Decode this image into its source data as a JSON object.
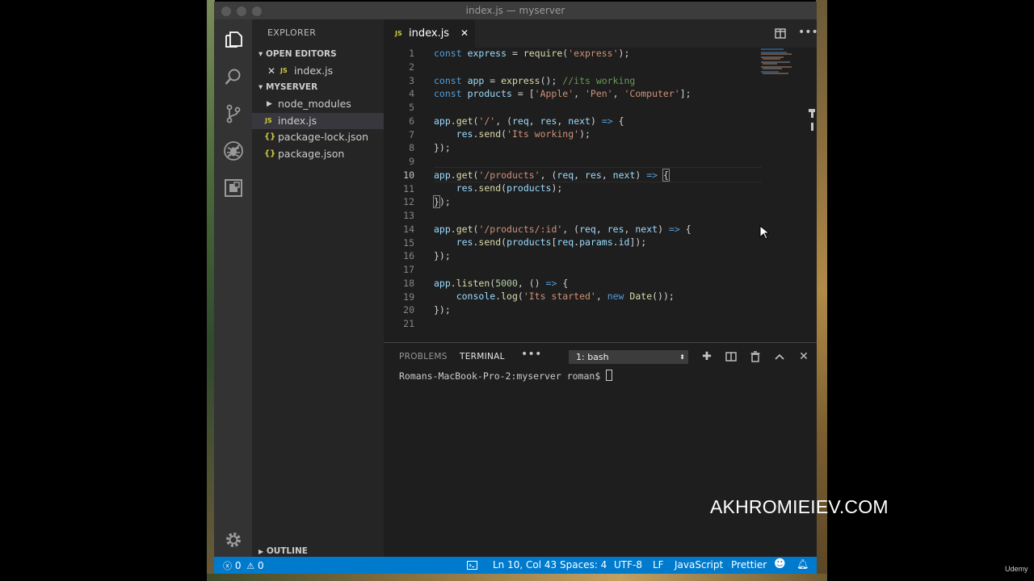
{
  "window": {
    "title": "index.js — myserver"
  },
  "sidebar": {
    "header": "EXPLORER",
    "open_editors_label": "OPEN EDITORS",
    "open_editors": [
      {
        "badge": "JS",
        "name": "index.js"
      }
    ],
    "project_label": "MYSERVER",
    "files": [
      {
        "type": "folder",
        "name": "node_modules"
      },
      {
        "type": "js",
        "badge": "JS",
        "name": "index.js"
      },
      {
        "type": "json",
        "badge": "{}",
        "name": "package-lock.json"
      },
      {
        "type": "json",
        "badge": "{}",
        "name": "package.json"
      }
    ],
    "outline_label": "OUTLINE"
  },
  "tabs": [
    {
      "badge": "JS",
      "label": "index.js"
    }
  ],
  "editor": {
    "line_numbers": [
      "1",
      "2",
      "3",
      "4",
      "5",
      "6",
      "7",
      "8",
      "9",
      "10",
      "11",
      "12",
      "13",
      "14",
      "15",
      "16",
      "17",
      "18",
      "19",
      "20",
      "21"
    ],
    "current_line": 10
  },
  "panel": {
    "tabs": [
      "PROBLEMS",
      "TERMINAL"
    ],
    "active_tab": "TERMINAL",
    "terminal_select": "1: bash",
    "terminal_prompt": "Romans-MacBook-Pro-2:myserver roman$ "
  },
  "statusbar": {
    "errors": "0",
    "warnings": "0",
    "position": "Ln 10, Col 43",
    "spaces": "Spaces: 4",
    "encoding": "UTF-8",
    "eol": "LF",
    "language": "JavaScript",
    "formatter": "Prettier"
  },
  "overlay": {
    "watermark": "AKHROMIEIEV.COM",
    "brand": "Udemy"
  },
  "colors": {
    "statusbar": "#007acc",
    "editor_bg": "#1e1e1e",
    "sidebar_bg": "#252526",
    "activitybar_bg": "#333333"
  }
}
